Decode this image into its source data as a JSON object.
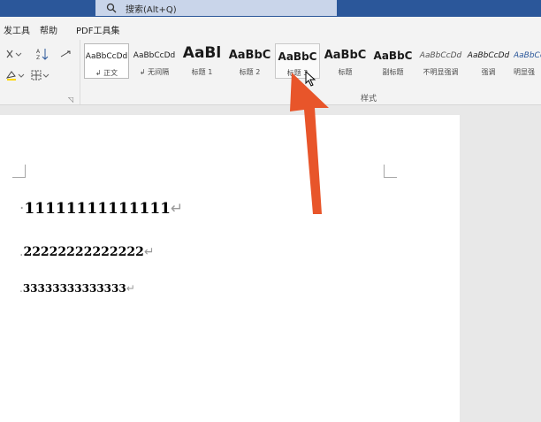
{
  "app": {
    "search_placeholder": "搜索(Alt+Q)"
  },
  "menu": {
    "items": [
      {
        "label": "发工具"
      },
      {
        "label": "帮助"
      },
      {
        "label": "PDF工具集"
      }
    ]
  },
  "ribbon": {
    "styles_group_label": "样式",
    "styles": [
      {
        "preview": "AaBbCcDd",
        "name": "↲ 正文"
      },
      {
        "preview": "AaBbCcDd",
        "name": "↲ 无间隔"
      },
      {
        "preview": "AaBl",
        "name": "标题 1"
      },
      {
        "preview": "AaBbC",
        "name": "标题 2"
      },
      {
        "preview": "AaBbC",
        "name": "标题 3"
      },
      {
        "preview": "AaBbC",
        "name": "标题"
      },
      {
        "preview": "AaBbC",
        "name": "副标题"
      },
      {
        "preview": "AaBbCcDd",
        "name": "不明显强调"
      },
      {
        "preview": "AaBbCcDd",
        "name": "强调"
      },
      {
        "preview": "AaBbCcDd",
        "name": "明显强"
      }
    ]
  },
  "document": {
    "paragraphs": [
      {
        "text": "11111111111111",
        "mark": "↵"
      },
      {
        "text": "22222222222222",
        "mark": "↵"
      },
      {
        "text": "33333333333333",
        "mark": "↵"
      }
    ]
  },
  "colors": {
    "title_bar": "#2b579a",
    "annotation_arrow": "#e8552a"
  },
  "annotation": {
    "arrow_icon": "up-arrow-icon"
  }
}
